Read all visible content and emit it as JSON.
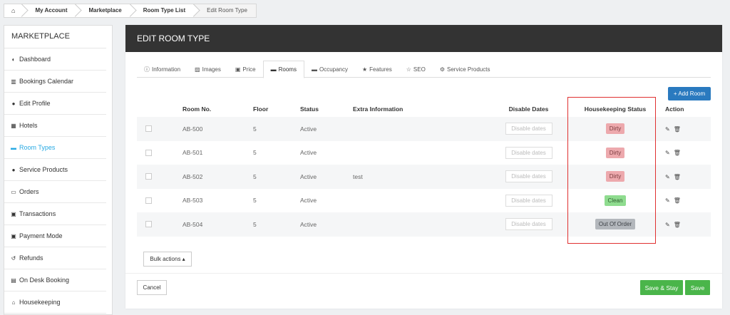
{
  "breadcrumb": {
    "home_icon": "home-icon",
    "items": [
      "My Account",
      "Marketplace",
      "Room Type List",
      "Edit Room Type"
    ]
  },
  "sidebar": {
    "title": "MARKETPLACE",
    "items": [
      {
        "label": "Dashboard",
        "icon": "dashboard-icon"
      },
      {
        "label": "Bookings Calendar",
        "icon": "chart-icon"
      },
      {
        "label": "Edit Profile",
        "icon": "user-icon"
      },
      {
        "label": "Hotels",
        "icon": "building-icon"
      },
      {
        "label": "Room Types",
        "icon": "bed-icon"
      },
      {
        "label": "Service Products",
        "icon": "user-plus-icon"
      },
      {
        "label": "Orders",
        "icon": "card-icon"
      },
      {
        "label": "Transactions",
        "icon": "money-icon"
      },
      {
        "label": "Payment Mode",
        "icon": "money-icon"
      },
      {
        "label": "Refunds",
        "icon": "undo-icon"
      },
      {
        "label": "On Desk Booking",
        "icon": "calendar-icon"
      },
      {
        "label": "Housekeeping",
        "icon": "home-icon"
      }
    ]
  },
  "panel": {
    "title": "EDIT ROOM TYPE",
    "tabs": [
      {
        "label": "Information",
        "icon": "info-icon"
      },
      {
        "label": "Images",
        "icon": "image-icon"
      },
      {
        "label": "Price",
        "icon": "money-icon"
      },
      {
        "label": "Rooms",
        "icon": "bed-icon"
      },
      {
        "label": "Occupancy",
        "icon": "bed-icon"
      },
      {
        "label": "Features",
        "icon": "star-icon"
      },
      {
        "label": "SEO",
        "icon": "star-outline-icon"
      },
      {
        "label": "Service Products",
        "icon": "gear-icon"
      }
    ],
    "add_room_label": "+ Add Room"
  },
  "table": {
    "headers": {
      "room_no": "Room No.",
      "floor": "Floor",
      "status": "Status",
      "extra": "Extra Information",
      "disable_dates": "Disable Dates",
      "housekeeping": "Housekeeping Status",
      "action": "Action"
    },
    "disable_placeholder": "Disable dates",
    "rows": [
      {
        "room": "AB-500",
        "floor": "5",
        "status": "Active",
        "extra": "",
        "hk": "Dirty"
      },
      {
        "room": "AB-501",
        "floor": "5",
        "status": "Active",
        "extra": "",
        "hk": "Dirty"
      },
      {
        "room": "AB-502",
        "floor": "5",
        "status": "Active",
        "extra": "test",
        "hk": "Dirty"
      },
      {
        "room": "AB-503",
        "floor": "5",
        "status": "Active",
        "extra": "",
        "hk": "Clean"
      },
      {
        "room": "AB-504",
        "floor": "5",
        "status": "Active",
        "extra": "",
        "hk": "Out Of Order"
      }
    ]
  },
  "buttons": {
    "bulk_actions": "Bulk actions ▴",
    "cancel": "Cancel",
    "save_stay": "Save & Stay",
    "save": "Save"
  },
  "colors": {
    "header_bg": "#333333",
    "accent": "#27a9e3",
    "add_button": "#2a7abf",
    "green_button": "#4ab54a",
    "dirty_badge": "#eda9ad",
    "clean_badge": "#8fdc8f",
    "ooo_badge": "#b3b7bc",
    "highlight_box": "#e03030"
  }
}
